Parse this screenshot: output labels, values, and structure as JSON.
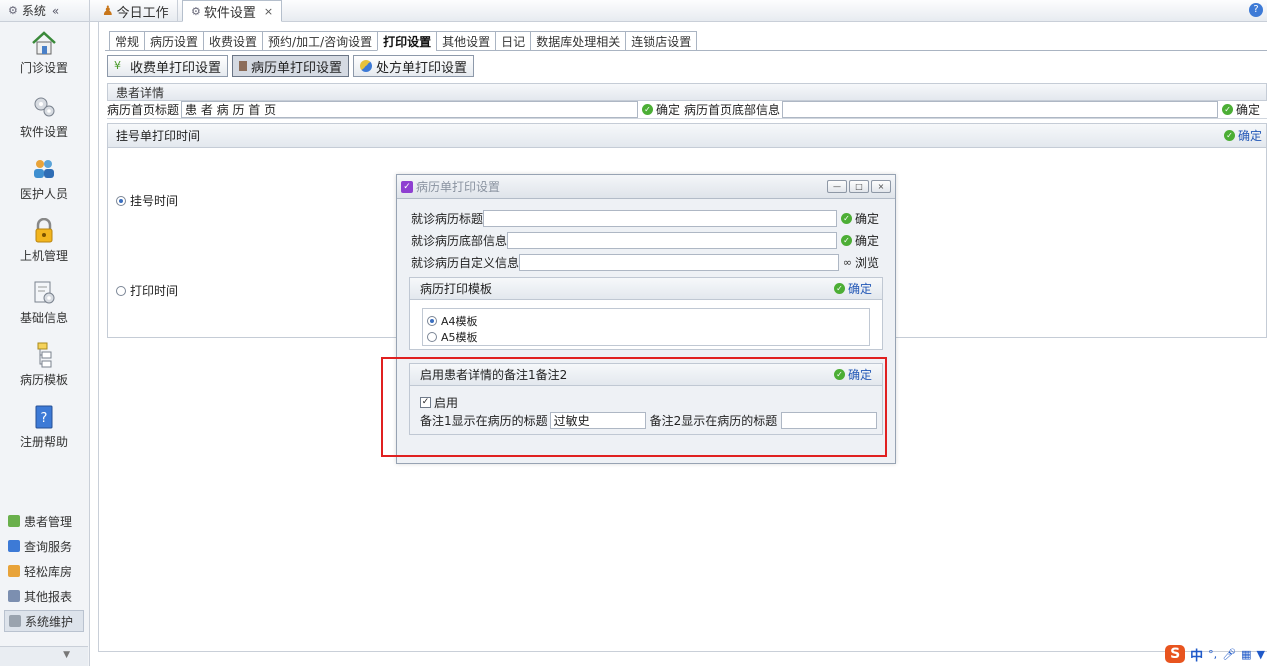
{
  "sidebar": {
    "header": "系统",
    "collapse": "«",
    "items": [
      {
        "label": "门诊设置",
        "icon": "house-icon"
      },
      {
        "label": "软件设置",
        "icon": "gears-icon"
      },
      {
        "label": "医护人员",
        "icon": "people-icon"
      },
      {
        "label": "上机管理",
        "icon": "lock-icon"
      },
      {
        "label": "基础信息",
        "icon": "settings-doc-icon"
      },
      {
        "label": "病历模板",
        "icon": "tree-icon"
      },
      {
        "label": "注册帮助",
        "icon": "help-book-icon"
      }
    ],
    "bottom_items": [
      {
        "label": "患者管理",
        "icon": "patients-icon"
      },
      {
        "label": "查询服务",
        "icon": "query-icon"
      },
      {
        "label": "轻松库房",
        "icon": "warehouse-icon"
      },
      {
        "label": "其他报表",
        "icon": "report-icon"
      },
      {
        "label": "系统维护",
        "icon": "maintenance-icon"
      }
    ]
  },
  "top_tabs": [
    {
      "label": "今日工作",
      "icon": "person-icon"
    },
    {
      "label": "软件设置",
      "icon": "gear-icon",
      "close": "×"
    }
  ],
  "sub_tabs": [
    "常规",
    "病历设置",
    "收费设置",
    "预约/加工/咨询设置",
    "打印设置",
    "其他设置",
    "日记",
    "数据库处理相关",
    "连锁店设置"
  ],
  "print_buttons": [
    "收费单打印设置",
    "病历单打印设置",
    "处方单打印设置"
  ],
  "patient_section": {
    "header": "患者详情",
    "title_label": "病历首页标题",
    "title_value": "患 者 病 历 首 页",
    "confirm": "确定",
    "footer_label": "病历首页底部信息",
    "footer_value": ""
  },
  "registration": {
    "header": "挂号单打印时间",
    "confirm": "确定",
    "option1": "挂号时间",
    "option2": "打印时间",
    "selected": "挂号时间"
  },
  "dialog": {
    "title": "病历单打印设置",
    "win_buttons": [
      "—",
      "□",
      "×"
    ],
    "rows": [
      {
        "label": "就诊病历标题",
        "value": "",
        "action": "确定"
      },
      {
        "label": "就诊病历底部信息",
        "value": "",
        "action": "确定"
      },
      {
        "label": "就诊病历自定义信息",
        "value": "",
        "action": "浏览"
      }
    ],
    "template": {
      "header": "病历打印模板",
      "confirm": "确定",
      "options": [
        "A4模板",
        "A5模板"
      ],
      "selected": "A4模板"
    },
    "remark": {
      "header": "启用患者详情的备注1备注2",
      "confirm": "确定",
      "enable_label": "启用",
      "enabled": true,
      "remark1_label": "备注1显示在病历的标题",
      "remark1_value": "过敏史",
      "remark2_label": "备注2显示在病历的标题",
      "remark2_value": ""
    }
  },
  "ime": {
    "mode": "中",
    "punct": "°,"
  },
  "colors": {
    "accent": "#2257b6",
    "ok_green": "#4cae35",
    "highlight_frame": "#e02020"
  }
}
